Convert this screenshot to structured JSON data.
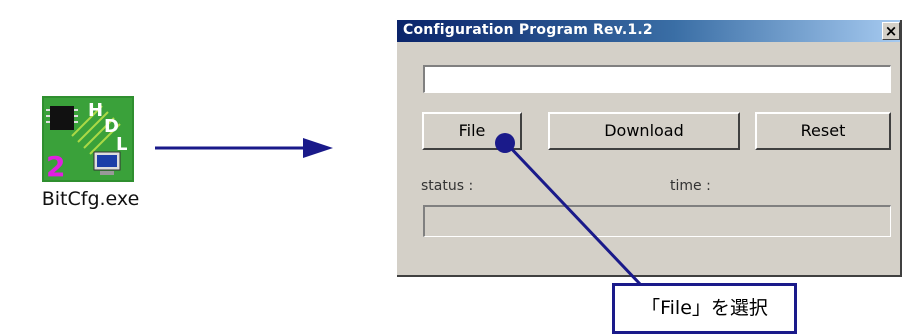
{
  "desktop_icon": {
    "label": "BitCfg.exe",
    "icon": "hdl-chip-app-icon"
  },
  "window": {
    "title": "Configuration Program  Rev.1.2",
    "close_label": "×",
    "file_path": "",
    "buttons": {
      "file": "File",
      "download": "Download",
      "reset": "Reset"
    },
    "status_label": "status :",
    "time_label": "time :",
    "status_value": ""
  },
  "callout": {
    "text": "「File」を選択"
  },
  "colors": {
    "accent": "#1a1a8a",
    "titlebar": "#0a246a",
    "window_bg": "#d4d0c8"
  }
}
